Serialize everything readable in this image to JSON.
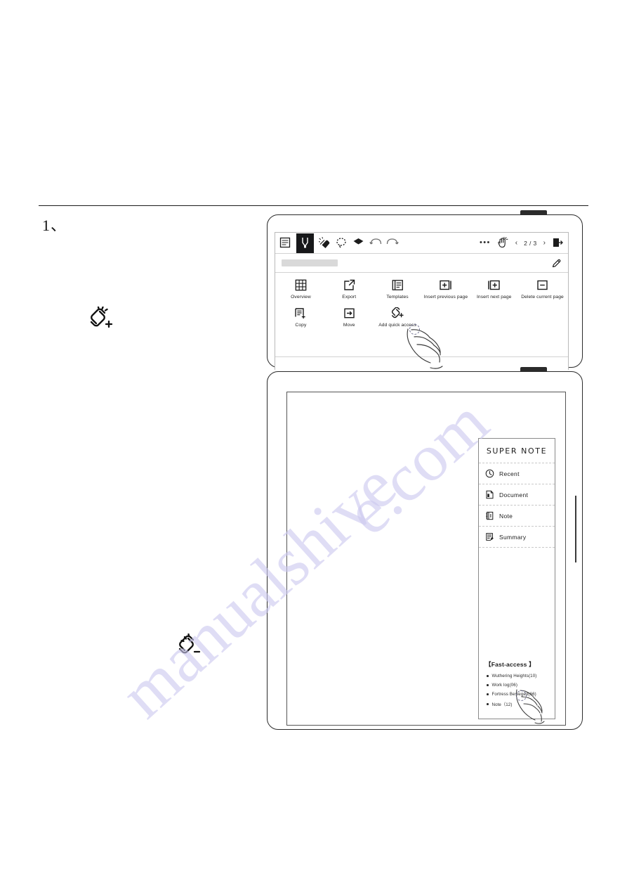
{
  "page": {
    "step_number": "1、"
  },
  "annotations": {
    "add_link_icon": "link-plus-icon",
    "remove_link_icon": "link-minus-icon"
  },
  "watermark": {
    "text_left": "manualshive",
    "text_right": "e.com"
  },
  "device1": {
    "toolbar": {
      "left_icons": [
        {
          "name": "menu-icon",
          "label": "Menu"
        },
        {
          "name": "pen-tool-icon",
          "label": "Pen",
          "selected": true
        },
        {
          "name": "eraser-icon",
          "label": "Eraser"
        },
        {
          "name": "lasso-select-icon",
          "label": "Lasso select"
        },
        {
          "name": "shape-fill-icon",
          "label": "Shape"
        },
        {
          "name": "undo-icon",
          "label": "Undo"
        },
        {
          "name": "redo-icon",
          "label": "Redo"
        }
      ],
      "more_label": "•••",
      "gesture_icon": "hand-gesture-icon",
      "prev_chevron": "‹",
      "page_indicator": "2 / 3",
      "next_chevron": "›",
      "exit_icon": "exit-icon"
    },
    "title_bar": {
      "title_value": "",
      "edit_icon": "pencil-icon"
    },
    "menu": {
      "row1": [
        {
          "icon": "grid-overview-icon",
          "label": "Overview"
        },
        {
          "icon": "export-icon",
          "label": "Export"
        },
        {
          "icon": "templates-icon",
          "label": "Templates"
        },
        {
          "icon": "insert-previous-page-icon",
          "label": "Insert previous page"
        },
        {
          "icon": "insert-next-page-icon",
          "label": "Insert next page"
        },
        {
          "icon": "delete-current-page-icon",
          "label": "Delete current page"
        }
      ],
      "row2": [
        {
          "icon": "copy-icon",
          "label": "Copy"
        },
        {
          "icon": "move-icon",
          "label": "Move"
        },
        {
          "icon": "add-quick-access-icon",
          "label": "Add quick access"
        }
      ]
    }
  },
  "device2": {
    "sidebar": {
      "title": "SUPER NOTE",
      "items": [
        {
          "icon": "clock-icon",
          "label": "Recent"
        },
        {
          "icon": "document-icon",
          "label": "Document"
        },
        {
          "icon": "note-icon",
          "label": "Note"
        },
        {
          "icon": "summary-icon",
          "label": "Summary"
        }
      ],
      "fast_access": {
        "title": "【Fast-access 】",
        "items": [
          "Wuthering Heights(10)",
          "Work log(06)",
          "Fortress Besieged(66)",
          "Note（12)"
        ]
      }
    }
  }
}
